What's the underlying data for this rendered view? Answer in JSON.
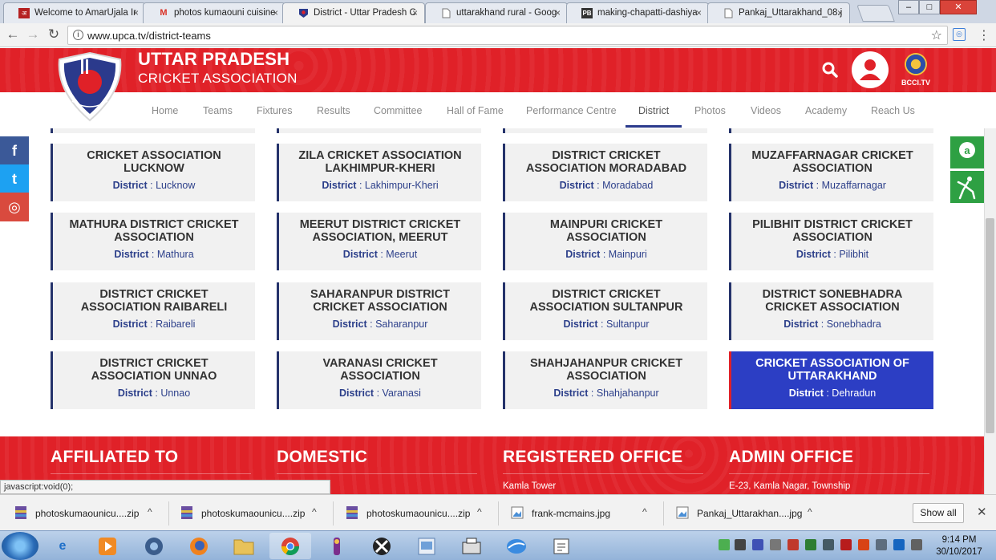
{
  "browser": {
    "tabs": [
      {
        "title": "Welcome to AmarUjala Ir",
        "favicon": "amarujala-icon"
      },
      {
        "title": "photos kumaouni cuisine",
        "favicon": "gmail-icon"
      },
      {
        "title": "District - Uttar Pradesh C",
        "favicon": "upca-icon",
        "active": true
      },
      {
        "title": "uttarakhand rural - Goog",
        "favicon": "page-icon"
      },
      {
        "title": "making-chapatti-dashiya",
        "favicon": "pdf-icon"
      },
      {
        "title": "Pankaj_Uttarakhand_08.j",
        "favicon": "page-icon"
      }
    ],
    "close_glyph": "×",
    "nav": {
      "back": "←",
      "forward": "→",
      "reload": "↻"
    },
    "url": "www.upca.tv/district-teams",
    "bookmark_star": "☆",
    "menu_dots": "⋮",
    "window_controls": {
      "minimize": "–",
      "maximize": "□",
      "close": "✕"
    }
  },
  "site": {
    "title": "UTTAR PRADESH",
    "subtitle": "CRICKET ASSOCIATION",
    "bcci_label": "BCCI.TV",
    "nav": [
      "Home",
      "Teams",
      "Fixtures",
      "Results",
      "Committee",
      "Hall of Fame",
      "Performance Centre",
      "District",
      "Photos",
      "Videos",
      "Academy",
      "Reach Us"
    ],
    "active_nav": "District",
    "colors": {
      "brand_red": "#e02128",
      "navy": "#25336b",
      "highlight_blue": "#2c3ec4",
      "district_text": "#2c3f8a"
    }
  },
  "district_label": "District",
  "district_separator": " : ",
  "cards": [
    {
      "name": "CRICKET ASSOCIATION LUCKNOW",
      "district": "Lucknow"
    },
    {
      "name": "ZILA CRICKET ASSOCIATION LAKHIMPUR-KHERI",
      "district": "Lakhimpur-Kheri"
    },
    {
      "name": "DISTRICT CRICKET ASSOCIATION MORADABAD",
      "district": "Moradabad"
    },
    {
      "name": "MUZAFFARNAGAR CRICKET ASSOCIATION",
      "district": "Muzaffarnagar"
    },
    {
      "name": "MATHURA DISTRICT CRICKET ASSOCIATION",
      "district": "Mathura"
    },
    {
      "name": "MEERUT DISTRICT CRICKET ASSOCIATION, MEERUT",
      "district": "Meerut"
    },
    {
      "name": "MAINPURI CRICKET ASSOCIATION",
      "district": "Mainpuri"
    },
    {
      "name": "PILIBHIT DISTRICT CRICKET ASSOCIATION",
      "district": "Pilibhit"
    },
    {
      "name": "DISTRICT CRICKET ASSOCIATION RAIBARELI",
      "district": "Raibareli"
    },
    {
      "name": "SAHARANPUR DISTRICT CRICKET ASSOCIATION",
      "district": "Saharanpur"
    },
    {
      "name": "DISTRICT CRICKET ASSOCIATION SULTANPUR",
      "district": "Sultanpur"
    },
    {
      "name": "DISTRICT SONEBHADRA CRICKET ASSOCIATION",
      "district": "Sonebhadra"
    },
    {
      "name": "DISTRICT CRICKET ASSOCIATION UNNAO",
      "district": "Unnao"
    },
    {
      "name": "VARANASI CRICKET ASSOCIATION",
      "district": "Varanasi"
    },
    {
      "name": "SHAHJAHANPUR CRICKET ASSOCIATION",
      "district": "Shahjahanpur"
    },
    {
      "name": "CRICKET ASSOCIATION OF UTTARAKHAND",
      "district": "Dehradun",
      "highlighted": true
    }
  ],
  "social": [
    {
      "name": "facebook-icon",
      "glyph": "f",
      "color": "#3b5998"
    },
    {
      "name": "twitter-icon",
      "glyph": "t",
      "color": "#1da1f2"
    },
    {
      "name": "instagram-icon",
      "glyph": "◎",
      "color": "#d94a3e"
    }
  ],
  "footer": {
    "sections": [
      {
        "heading": "AFFILIATED TO",
        "line": ""
      },
      {
        "heading": "DOMESTIC",
        "line": ""
      },
      {
        "heading": "REGISTERED OFFICE",
        "line": "Kamla Tower"
      },
      {
        "heading": "ADMIN OFFICE",
        "line": "E-23, Kamla Nagar, Township"
      }
    ]
  },
  "status_text": "javascript:void(0);",
  "downloads": {
    "items": [
      {
        "name": "photoskumaounicu....zip",
        "kind": "zip"
      },
      {
        "name": "photoskumaounicu....zip",
        "kind": "zip"
      },
      {
        "name": "photoskumaounicu....zip",
        "kind": "zip"
      },
      {
        "name": "frank-mcmains.jpg",
        "kind": "image"
      },
      {
        "name": "Pankaj_Uttarakhan....jpg",
        "kind": "image"
      }
    ],
    "caret": "^",
    "show_all": "Show all",
    "close": "✕"
  },
  "taskbar": {
    "time": "9:14 PM",
    "date": "30/10/2017"
  }
}
